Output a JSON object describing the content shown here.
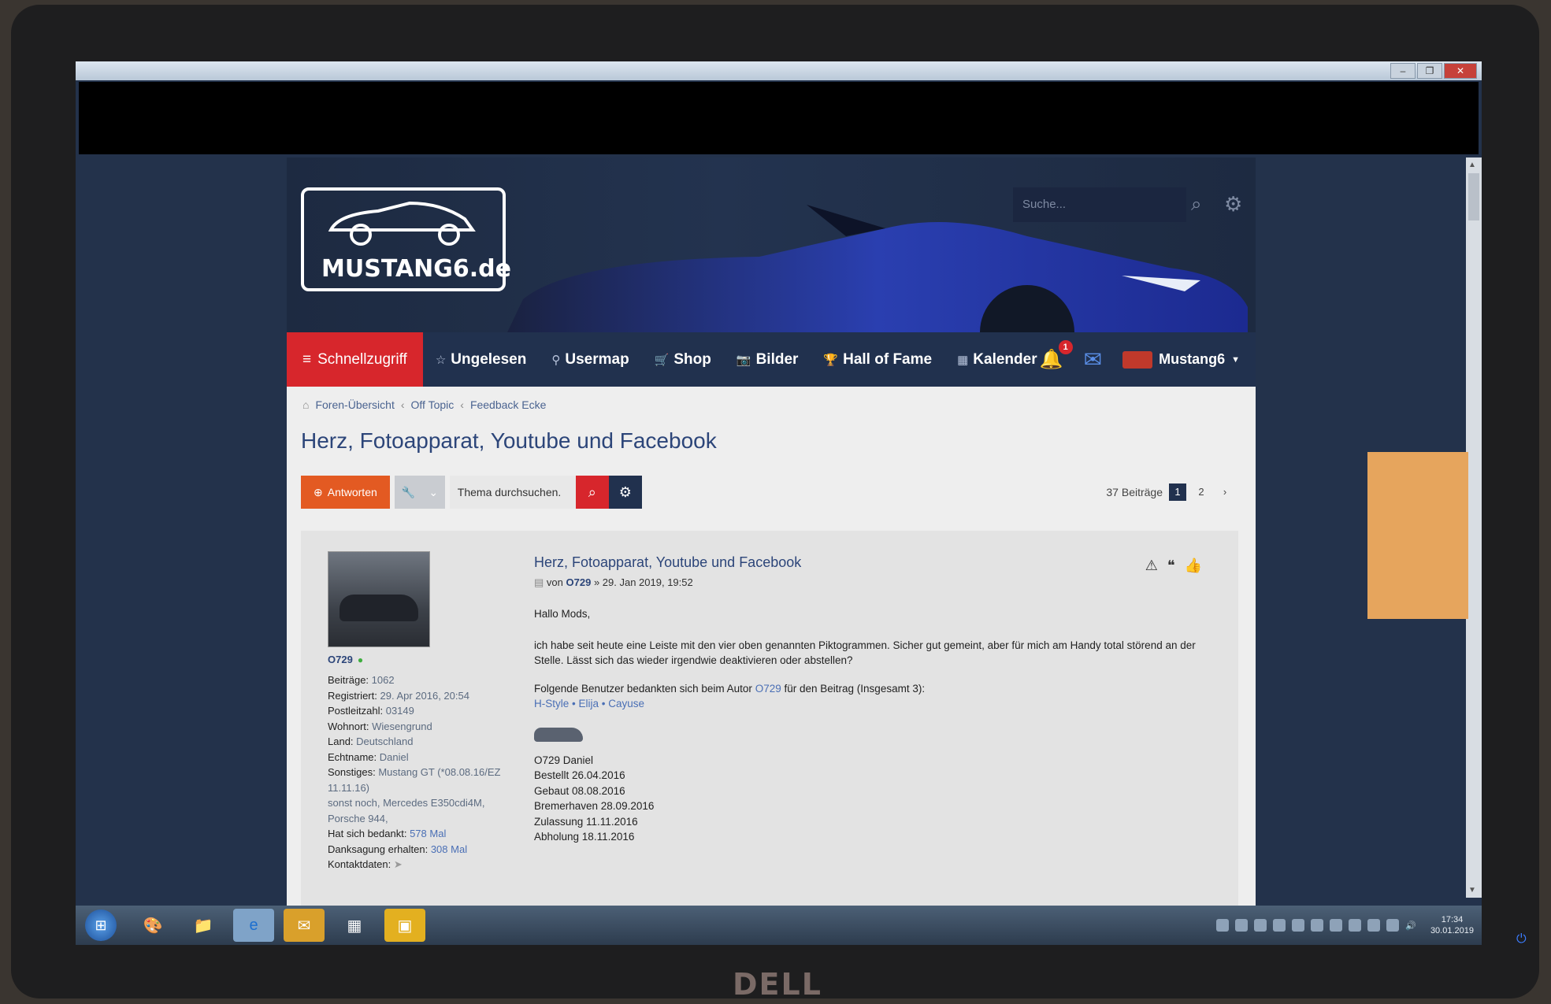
{
  "header": {
    "logo_text": "MUSTANG6.de",
    "search_placeholder": "Suche..."
  },
  "nav": {
    "quick_access": "Schnellzugriff",
    "items": [
      {
        "label": "Ungelesen",
        "icon": "star-icon"
      },
      {
        "label": "Usermap",
        "icon": "map-pin-icon"
      },
      {
        "label": "Shop",
        "icon": "cart-icon"
      },
      {
        "label": "Bilder",
        "icon": "camera-icon"
      },
      {
        "label": "Hall of Fame",
        "icon": "trophy-icon"
      },
      {
        "label": "Kalender",
        "icon": "calendar-icon"
      }
    ],
    "notification_count": "1",
    "username": "Mustang6"
  },
  "breadcrumb": [
    "Foren-Übersicht",
    "Off Topic",
    "Feedback Ecke"
  ],
  "topic": {
    "title": "Herz, Fotoapparat, Youtube und Facebook",
    "reply_label": "Antworten",
    "search_placeholder": "Thema durchsuchen.",
    "post_count": "37 Beiträge",
    "pages": [
      "1",
      "2"
    ],
    "current_page": "1"
  },
  "post": {
    "title": "Herz, Fotoapparat, Youtube und Facebook",
    "by": "von",
    "author": "O729",
    "date": "» 29. Jan 2019, 19:52",
    "greeting": "Hallo Mods,",
    "body": "ich habe seit heute eine Leiste mit den vier oben genannten Piktogrammen. Sicher gut gemeint, aber für mich am Handy total störend an der Stelle. Lässt sich das wieder irgendwie deaktivieren oder abstellen?",
    "thanks_prefix": "Folgende Benutzer bedankten sich beim Autor",
    "thanks_author": "O729",
    "thanks_suffix": "für den Beitrag (Insgesamt 3):",
    "thanks_users": "H-Style • Elija • Cayuse",
    "signature": [
      "O729 Daniel",
      "Bestellt 26.04.2016",
      "Gebaut 08.08.2016",
      "Bremerhaven 28.09.2016",
      "Zulassung 11.11.2016",
      "Abholung 18.11.2016"
    ]
  },
  "profile": {
    "name": "O729",
    "beitraege_label": "Beiträge:",
    "beitraege": "1062",
    "registriert_label": "Registriert:",
    "registriert": "29. Apr 2016, 20:54",
    "plz_label": "Postleitzahl:",
    "plz": "03149",
    "wohnort_label": "Wohnort:",
    "wohnort": "Wiesengrund",
    "land_label": "Land:",
    "land": "Deutschland",
    "echtname_label": "Echtname:",
    "echtname": "Daniel",
    "sonstiges_label": "Sonstiges:",
    "sonstiges": "Mustang GT (*08.08.16/EZ 11.11.16)",
    "sonstiges2": "sonst noch, Mercedes E350cdi4M, Porsche 944,",
    "bedankt_label": "Hat sich bedankt:",
    "bedankt": "578 Mal",
    "danksagung_label": "Danksagung erhalten:",
    "danksagung": "308 Mal",
    "kontakt_label": "Kontaktdaten:"
  },
  "taskbar": {
    "clock_time": "17:34",
    "clock_date": "30.01.2019"
  },
  "monitor": {
    "brand": "DELL"
  }
}
